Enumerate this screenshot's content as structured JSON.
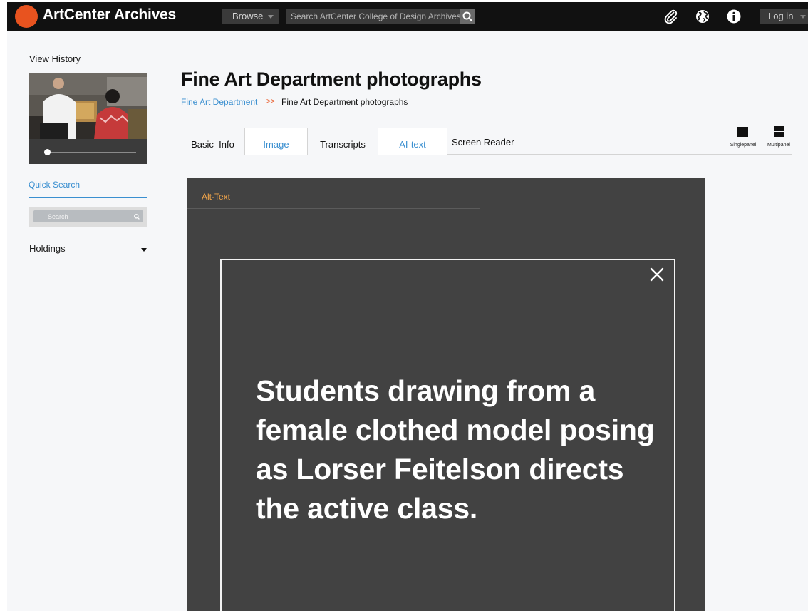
{
  "header": {
    "brand": "ArtCenter Archives",
    "browse_label": "Browse",
    "search_placeholder": "Search ArtCenter College of Design Archives",
    "login_label": "Log in",
    "icons": [
      "paperclip-icon",
      "globe-icon",
      "info-icon",
      "search-icon"
    ]
  },
  "sidebar": {
    "view_history": "View History",
    "quick_search": "Quick Search",
    "search_placeholder": "Search",
    "holdings": "Holdings",
    "slider_value": 0
  },
  "main": {
    "title": "Fine Art Department photographs",
    "breadcrumb": {
      "parent": "Fine Art Department",
      "separator": ">>",
      "current": "Fine Art Department photographs"
    },
    "tabs": [
      {
        "label": "Basic  Info"
      },
      {
        "label": "Image"
      },
      {
        "label": "Transcripts"
      },
      {
        "label": "AI-text"
      },
      {
        "label": "Screen Reader"
      }
    ],
    "views": {
      "single": "Singlepanel",
      "multi": "Multipanel"
    }
  },
  "viewer": {
    "tab_label": "Alt-Text",
    "alt_text": "Students drawing from a female clothed model posing as Lorser Feitelson directs the active class."
  },
  "colors": {
    "accent_blue": "#3a8fd0",
    "brand_orange": "#e8531f",
    "alt_tab_orange": "#f0a44a",
    "topbar": "#111111",
    "viewer_bg": "#424242"
  }
}
